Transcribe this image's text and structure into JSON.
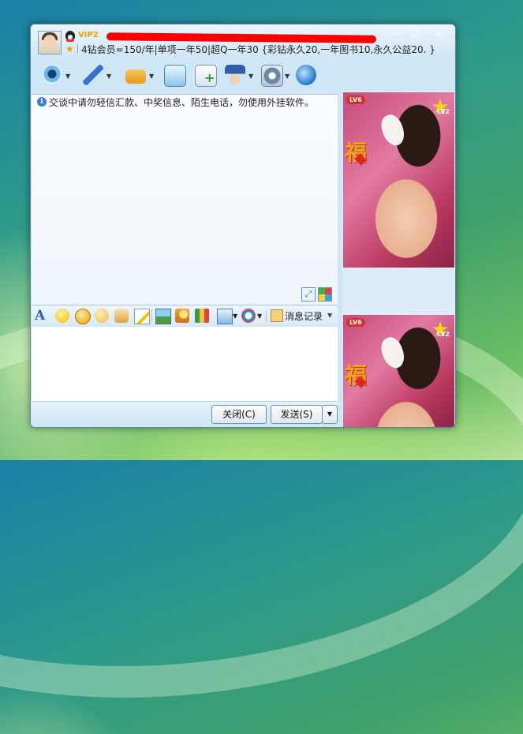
{
  "titlebar": {
    "vip_label": "VIP2",
    "signature": "4钻会员=150/年|单项一年50|超Q一年30 {彩钻永久20,一年图书10,永久公益20. }",
    "window_buttons": {
      "minimize": "—",
      "maximize": "☐",
      "close": "✕"
    }
  },
  "toolbar": {
    "items": [
      {
        "icon": "webcam-icon",
        "color": "#3a8fd8",
        "has_dropdown": true
      },
      {
        "icon": "microphone-icon",
        "color": "#3c6fd0",
        "has_dropdown": true
      },
      {
        "icon": "send-file-icon",
        "color": "#f0a52a",
        "has_dropdown": true
      },
      {
        "icon": "whiteboard-icon",
        "color": "#4aa0d8",
        "has_dropdown": false
      },
      {
        "icon": "add-note-icon",
        "color": "#36a84a",
        "has_dropdown": false
      },
      {
        "icon": "remote-assist-icon",
        "color": "#2f5da8",
        "has_dropdown": true
      },
      {
        "icon": "apps-icon",
        "color": "#6d86a6",
        "has_dropdown": true
      },
      {
        "icon": "share-screen-icon",
        "color": "#2f86d0",
        "has_dropdown": false
      }
    ]
  },
  "chat": {
    "notice_icon": "i",
    "notice": "交谈中请勿轻信汇款、中奖信息、陌生电话，勿使用外挂软件。"
  },
  "format_bar": {
    "font_glyph": "A",
    "message_log_label": "消息记录"
  },
  "buttons": {
    "close_label": "关闭(C)",
    "send_label": "发送(S)"
  },
  "ads": {
    "level_badge": "LV6",
    "level2_badge": "LV2",
    "fu_char": "福"
  },
  "colors": {
    "window_bg": "#cfe6f6",
    "redaction": "#ff0000",
    "desktop_green": "#3fa06c"
  }
}
